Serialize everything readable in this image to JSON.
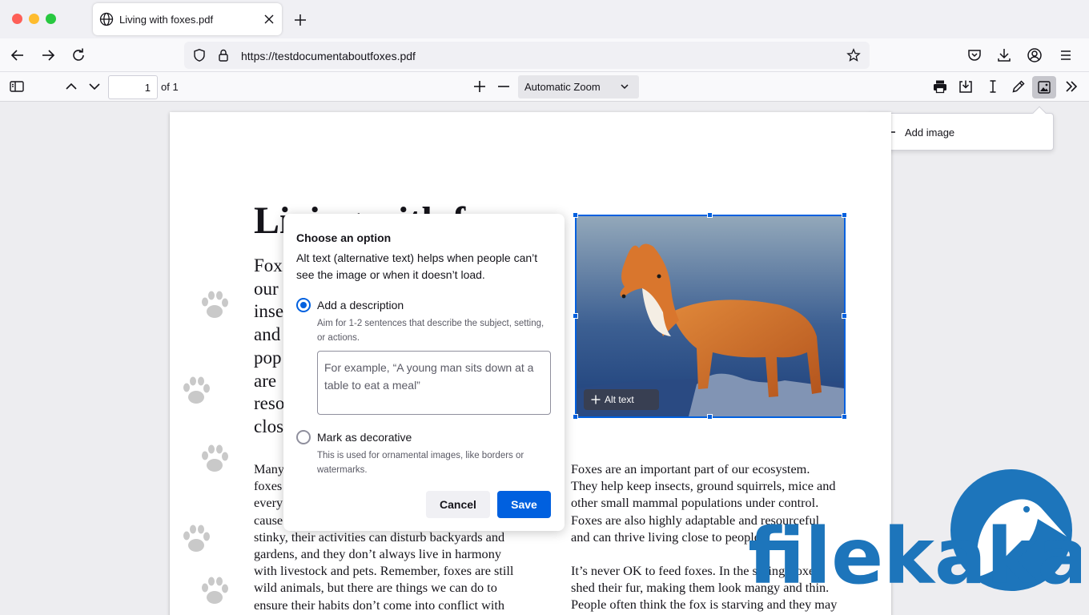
{
  "tab": {
    "title": "Living with foxes.pdf"
  },
  "navbar": {
    "url": "https://testdocumentaboutfoxes.pdf"
  },
  "pdf_toolbar": {
    "page_number": "1",
    "of_pages": "of 1",
    "zoom": "Automatic Zoom"
  },
  "add_image_menu": {
    "label": "Add image"
  },
  "document": {
    "title": "Living with f",
    "lead_lines": [
      "Fox",
      "our",
      "inse",
      "and",
      "pop",
      "are",
      "reso",
      "clos"
    ],
    "left_column": [
      "Many",
      "foxes",
      "every",
      "cause",
      "stinky, their activities can disturb backyards and",
      "gardens, and they don’t always live in harmony",
      "with livestock and pets. Remember, foxes are still",
      "wild animals, but there are things we can do to",
      "ensure their habits don’t come into conflict with"
    ],
    "right_column_p1": [
      "Foxes are an important part of our ecosystem.",
      "They help keep insects, ground squirrels, mice and",
      "other small mammal populations under control.",
      "Foxes are also highly adaptable and resourceful",
      "and can thrive living close to people."
    ],
    "right_column_p2": [
      "It’s never OK to feed foxes. In the spring, foxes",
      "shed their fur, making them look mangy and thin.",
      "People often think the fox is starving and they may"
    ],
    "alt_text_button": "Alt text"
  },
  "dialog": {
    "heading": "Choose an option",
    "description": "Alt text (alternative text) helps when people can’t see the image or when it doesn’t load.",
    "option_describe": "Add a description",
    "option_describe_hint": "Aim for 1-2 sentences that describe the subject, setting, or actions.",
    "textarea_placeholder": "For example, “A young man sits down at a table to eat a meal”",
    "option_decorative": "Mark as decorative",
    "option_decorative_hint": "This is used for ornamental images, like borders or watermarks.",
    "cancel": "Cancel",
    "save": "Save"
  },
  "watermark": {
    "text": "filekaka"
  },
  "colors": {
    "accent": "#0060df",
    "watermark": "#1d75bb"
  }
}
